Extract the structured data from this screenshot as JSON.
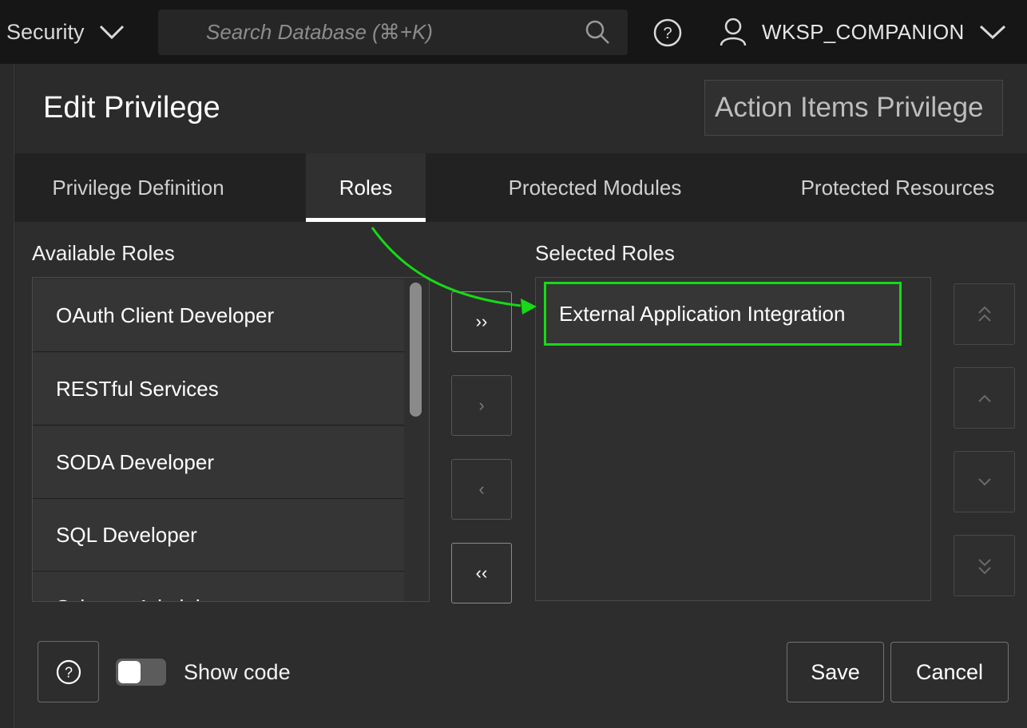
{
  "topbar": {
    "crumb_label": "Security",
    "search_placeholder": "Search Database (⌘+K)",
    "user_name": "WKSP_COMPANION"
  },
  "panel": {
    "title": "Edit Privilege",
    "privilege_name": "Action Items Privilege"
  },
  "tabs": [
    {
      "label": "Privilege Definition"
    },
    {
      "label": "Roles",
      "active": true
    },
    {
      "label": "Protected Modules"
    },
    {
      "label": "Protected Resources"
    }
  ],
  "shuttle": {
    "available_label": "Available Roles",
    "selected_label": "Selected Roles",
    "available_items": [
      "OAuth Client Developer",
      "RESTful Services",
      "SODA Developer",
      "SQL Developer",
      "Schema Administrator"
    ],
    "selected_items": [
      "External Application Integration"
    ],
    "move_all_right": "››",
    "move_right": "›",
    "move_left": "‹",
    "move_all_left": "‹‹"
  },
  "footer": {
    "show_code_label": "Show code",
    "show_code_on": false,
    "save_label": "Save",
    "cancel_label": "Cancel"
  },
  "colors": {
    "highlight": "#17d917",
    "background": "#2d2d2d",
    "topbar": "#161616"
  }
}
